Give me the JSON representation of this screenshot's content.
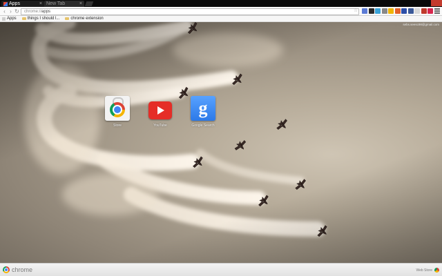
{
  "tabs": [
    {
      "label": "Apps",
      "active": true
    },
    {
      "label": "New Tab",
      "active": false
    }
  ],
  "toolbar": {
    "url_scheme": "chrome://",
    "url_path": "apps",
    "extension_colors": [
      "#5b7bd5",
      "#2a2a2a",
      "#3aa3d8",
      "#888888",
      "#f0b400",
      "#e3622b",
      "#2c4ea8",
      "#3b5998",
      "#d9d9d9",
      "#c0392b",
      "#d7264d"
    ]
  },
  "bookmarks": [
    {
      "label": "Apps",
      "icon": "apps-grid-icon"
    },
    {
      "label": "things I should l...",
      "icon": "folder-icon"
    },
    {
      "label": "chrome extension",
      "icon": "folder-icon"
    }
  ],
  "account": {
    "email": "sebs.seesc98@gmail.com"
  },
  "apps": [
    {
      "name": "Store",
      "icon": "chrome-web-store-icon"
    },
    {
      "name": "YouTube",
      "icon": "youtube-icon"
    },
    {
      "name": "Google Search",
      "icon": "google-search-icon",
      "glyph": "g"
    }
  ],
  "bottom_bar": {
    "brand": "chrome",
    "web_store": "Web Store"
  }
}
